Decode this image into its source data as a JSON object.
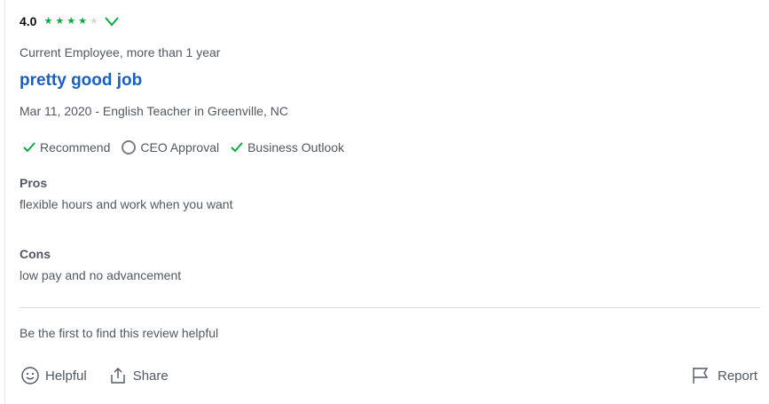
{
  "rating": {
    "value": "4.0",
    "stars_filled": 4,
    "stars_total": 5,
    "star_color": "#0caa41"
  },
  "review": {
    "employee_status": "Current Employee, more than 1 year",
    "title": "pretty good job",
    "meta": "Mar 11, 2020 - English Teacher in Greenville, NC",
    "title_color": "#1861bf"
  },
  "indicators": [
    {
      "label": "Recommend",
      "icon": "check-icon",
      "state": "positive"
    },
    {
      "label": "CEO Approval",
      "icon": "circle-icon",
      "state": "neutral"
    },
    {
      "label": "Business Outlook",
      "icon": "check-icon",
      "state": "positive"
    }
  ],
  "pros": {
    "heading": "Pros",
    "text": "flexible hours and work when you want"
  },
  "cons": {
    "heading": "Cons",
    "text": "low pay and no advancement"
  },
  "footer": {
    "helpful_prompt": "Be the first to find this review helpful",
    "helpful_label": "Helpful",
    "share_label": "Share",
    "report_label": "Report"
  },
  "colors": {
    "accent_green": "#0caa41",
    "text": "#505863",
    "link": "#1861bf"
  }
}
